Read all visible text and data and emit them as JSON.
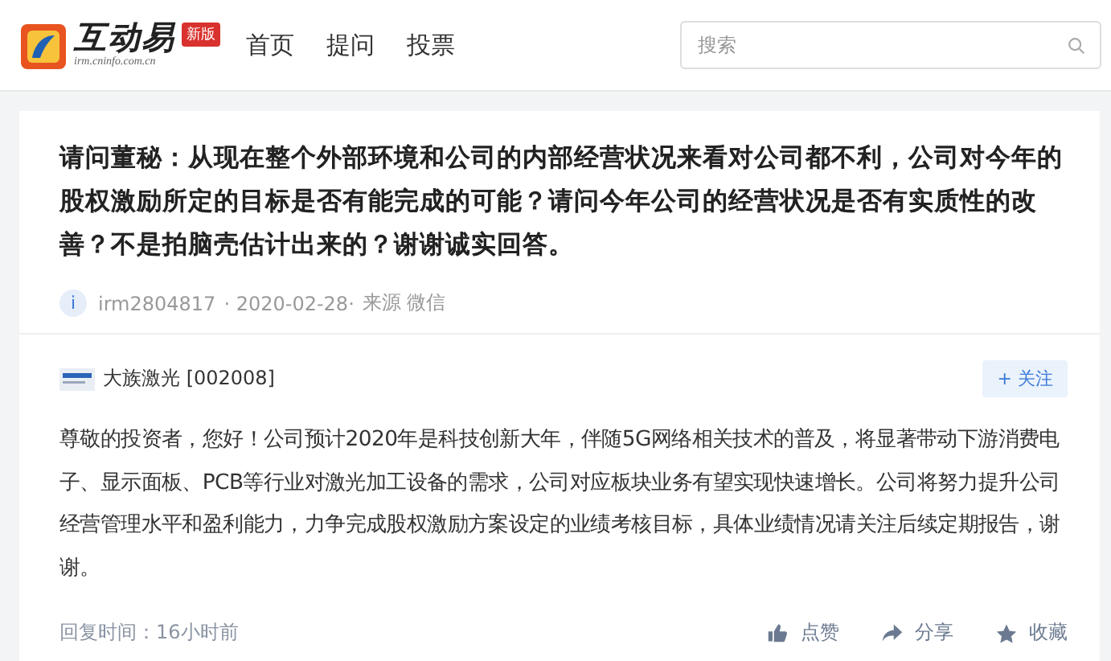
{
  "header": {
    "logo": {
      "name": "互动易",
      "domain": "irm.cninfo.com.cn",
      "badge": "新版"
    },
    "nav": [
      {
        "label": "首页"
      },
      {
        "label": "提问"
      },
      {
        "label": "投票"
      }
    ],
    "search": {
      "placeholder": "搜索"
    }
  },
  "question": {
    "text": "请问董秘：从现在整个外部环境和公司的内部经营状况来看对公司都不利，公司对今年的股权激励所定的目标是否有能完成的可能？请问今年公司的经营状况是否有实质性的改善？不是拍脑壳估计出来的？谢谢诚实回答。",
    "avatar": "i",
    "user": "irm2804817",
    "date": "· 2020-02-28·",
    "source": "来源 微信"
  },
  "answer": {
    "company": "大族激光 [002008]",
    "follow": "+ 关注",
    "text": "尊敬的投资者，您好！公司预计2020年是科技创新大年，伴随5G网络相关技术的普及，将显著带动下游消费电子、显示面板、PCB等行业对激光加工设备的需求，公司对应板块业务有望实现快速增长。公司将努力提升公司经营管理水平和盈利能力，力争完成股权激励方案设定的业绩考核目标，具体业绩情况请关注后续定期报告，谢谢。",
    "reply_time": "回复时间：16小时前",
    "actions": [
      {
        "kind": "like",
        "label": "点赞"
      },
      {
        "kind": "share",
        "label": "分享"
      },
      {
        "kind": "favorite",
        "label": "收藏"
      }
    ]
  }
}
